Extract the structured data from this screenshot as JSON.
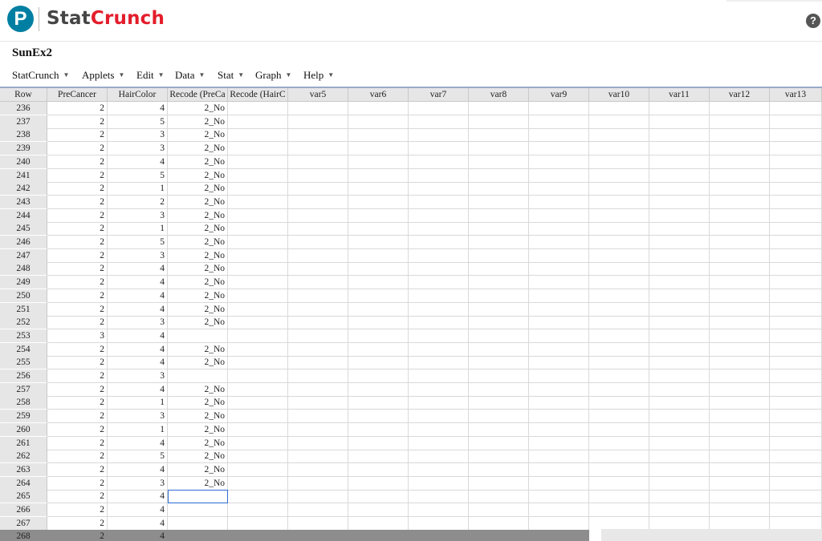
{
  "app": {
    "name_part1": "Stat",
    "name_part2": "Crunch",
    "logo_letter": "P",
    "help_glyph": "?"
  },
  "sheet": {
    "title": "SunEx2"
  },
  "menu": [
    {
      "label": "StatCrunch"
    },
    {
      "label": "Applets"
    },
    {
      "label": "Edit"
    },
    {
      "label": "Data"
    },
    {
      "label": "Stat"
    },
    {
      "label": "Graph"
    },
    {
      "label": "Help"
    }
  ],
  "columns": [
    "Row",
    "PreCancer",
    "HairColor",
    "Recode (PreCa",
    "Recode (HairC",
    "var5",
    "var6",
    "var7",
    "var8",
    "var9",
    "var10",
    "var11",
    "var12",
    "var13"
  ],
  "rows": [
    [
      "236",
      "2",
      "4",
      "2_No"
    ],
    [
      "237",
      "2",
      "5",
      "2_No"
    ],
    [
      "238",
      "2",
      "3",
      "2_No"
    ],
    [
      "239",
      "2",
      "3",
      "2_No"
    ],
    [
      "240",
      "2",
      "4",
      "2_No"
    ],
    [
      "241",
      "2",
      "5",
      "2_No"
    ],
    [
      "242",
      "2",
      "1",
      "2_No"
    ],
    [
      "243",
      "2",
      "2",
      "2_No"
    ],
    [
      "244",
      "2",
      "3",
      "2_No"
    ],
    [
      "245",
      "2",
      "1",
      "2_No"
    ],
    [
      "246",
      "2",
      "5",
      "2_No"
    ],
    [
      "247",
      "2",
      "3",
      "2_No"
    ],
    [
      "248",
      "2",
      "4",
      "2_No"
    ],
    [
      "249",
      "2",
      "4",
      "2_No"
    ],
    [
      "250",
      "2",
      "4",
      "2_No"
    ],
    [
      "251",
      "2",
      "4",
      "2_No"
    ],
    [
      "252",
      "2",
      "3",
      "2_No"
    ],
    [
      "253",
      "3",
      "4",
      ""
    ],
    [
      "254",
      "2",
      "4",
      "2_No"
    ],
    [
      "255",
      "2",
      "4",
      "2_No"
    ],
    [
      "256",
      "2",
      "3",
      ""
    ],
    [
      "257",
      "2",
      "4",
      "2_No"
    ],
    [
      "258",
      "2",
      "1",
      "2_No"
    ],
    [
      "259",
      "2",
      "3",
      "2_No"
    ],
    [
      "260",
      "2",
      "1",
      "2_No"
    ],
    [
      "261",
      "2",
      "4",
      "2_No"
    ],
    [
      "262",
      "2",
      "5",
      "2_No"
    ],
    [
      "263",
      "2",
      "4",
      "2_No"
    ],
    [
      "264",
      "2",
      "3",
      "2_No"
    ],
    [
      "265",
      "2",
      "4",
      ""
    ],
    [
      "266",
      "2",
      "4",
      ""
    ],
    [
      "267",
      "2",
      "4",
      ""
    ],
    [
      "268",
      "2",
      "4",
      ""
    ]
  ],
  "selected_cell": {
    "row": "265",
    "column": "Recode (PreCa"
  },
  "colors": {
    "brand_blue": "#007fa3",
    "brand_red": "#e31d2b",
    "header_gray": "#e6e6e6",
    "selection_blue": "#2c6bd3"
  }
}
